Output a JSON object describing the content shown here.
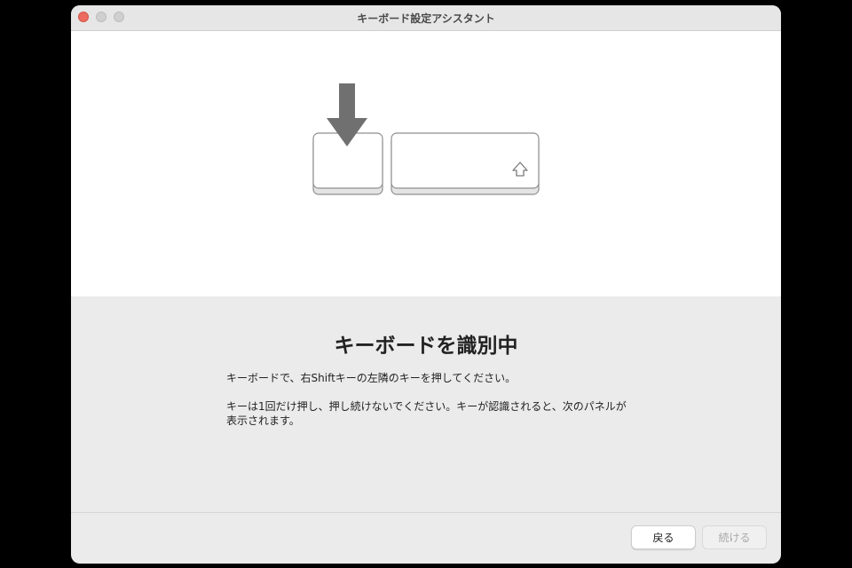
{
  "window": {
    "title": "キーボード設定アシスタント"
  },
  "illustration": {
    "pressed_key_indicator": "down-arrow-icon",
    "right_shift_key_symbol": "⇧"
  },
  "content": {
    "heading": "キーボードを識別中",
    "instruction_1": "キーボードで、右Shiftキーの左隣のキーを押してください。",
    "instruction_2": "キーは1回だけ押し、押し続けないでください。キーが認識されると、次のパネルが表示されます。"
  },
  "buttons": {
    "back": "戻る",
    "continue": "続ける",
    "continue_enabled": false
  },
  "colors": {
    "close": "#ec6a5e",
    "arrow": "#707070"
  }
}
